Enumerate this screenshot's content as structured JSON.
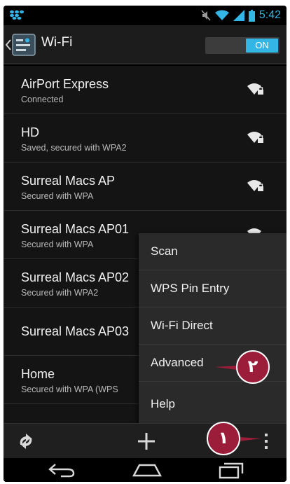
{
  "status_bar": {
    "time": "5:42",
    "icons": [
      "blackberry-icon",
      "mute-icon",
      "wifi-signal-icon",
      "cell-signal-icon",
      "battery-icon"
    ]
  },
  "action_bar": {
    "title": "Wi-Fi",
    "toggle_label": "ON",
    "app_icon": "wifi-settings-app-icon",
    "accent": "#33b5e5"
  },
  "networks": [
    {
      "name": "AirPort Express",
      "status": "Connected"
    },
    {
      "name": "HD",
      "status": "Saved, secured with WPA2"
    },
    {
      "name": "Surreal Macs AP",
      "status": "Secured with WPA"
    },
    {
      "name": "Surreal Macs AP01",
      "status": "Secured with WPA"
    },
    {
      "name": "Surreal Macs AP02",
      "status": "Secured with WPA2"
    },
    {
      "name": "Surreal Macs AP03",
      "status": ""
    },
    {
      "name": "Home",
      "status": "Secured with WPA (WPS"
    }
  ],
  "menu": {
    "items": [
      "Scan",
      "WPS Pin Entry",
      "Wi-Fi Direct",
      "Advanced",
      "Help"
    ]
  },
  "bottom_bar": {
    "icons": [
      "wps-refresh-icon",
      "add-network-icon",
      "overflow-menu-icon"
    ]
  },
  "nav_bar": {
    "icons": [
      "back-icon",
      "home-icon",
      "recent-apps-icon"
    ]
  },
  "callouts": {
    "step1": "١",
    "step2": "٢",
    "color": "#9b1d3a"
  }
}
